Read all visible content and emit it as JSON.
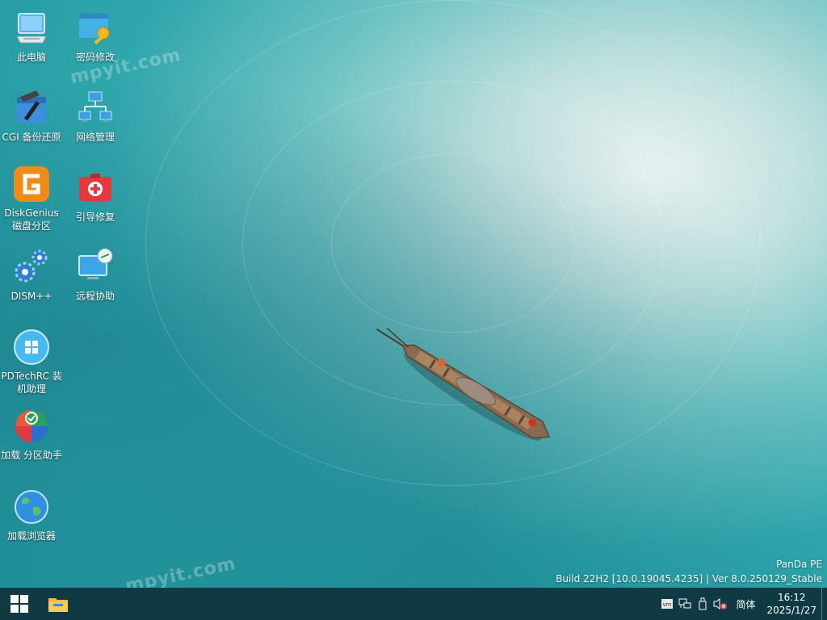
{
  "desktop": {
    "icons": [
      {
        "label": "此电脑",
        "icon": "computer-icon"
      },
      {
        "label": "密码修改",
        "icon": "password-key-icon"
      },
      {
        "label": "CGI 备份还原",
        "icon": "cgi-backup-icon"
      },
      {
        "label": "网络管理",
        "icon": "network-icon"
      },
      {
        "label": "DiskGenius 磁盘分区",
        "icon": "diskgenius-icon"
      },
      {
        "label": "引导修复",
        "icon": "boot-repair-icon"
      },
      {
        "label": "DISM++",
        "icon": "dism-gears-icon"
      },
      {
        "label": "远程协助",
        "icon": "remote-assist-icon"
      },
      {
        "label": "PDTechRC 装机助理",
        "icon": "pdtechrc-icon"
      },
      {
        "label": "加载 分区助手",
        "icon": "partition-assistant-icon"
      },
      {
        "label": "加载浏览器",
        "icon": "browser-globe-icon"
      }
    ],
    "watermarks": [
      "mpyit.com",
      "mpyit.com"
    ],
    "build_info": {
      "line1": "PanDa  PE",
      "line2": "Build  22H2  [10.0.19045.4235]  |  Ver  8.0.250129_Stable"
    }
  },
  "taskbar": {
    "start_icon": "windows-logo-icon",
    "pinned": [
      {
        "icon": "file-explorer-icon"
      }
    ],
    "tray": {
      "icons": [
        "vmware-icon",
        "network-icon",
        "usb-device-icon",
        "volume-muted-icon"
      ],
      "ime": "简体",
      "time": "16:12",
      "date": "2025/1/27"
    }
  },
  "colors": {
    "taskbar_bg": "#0f3a44",
    "water_deep": "#1e8d96",
    "water_light": "#bfe0de"
  }
}
